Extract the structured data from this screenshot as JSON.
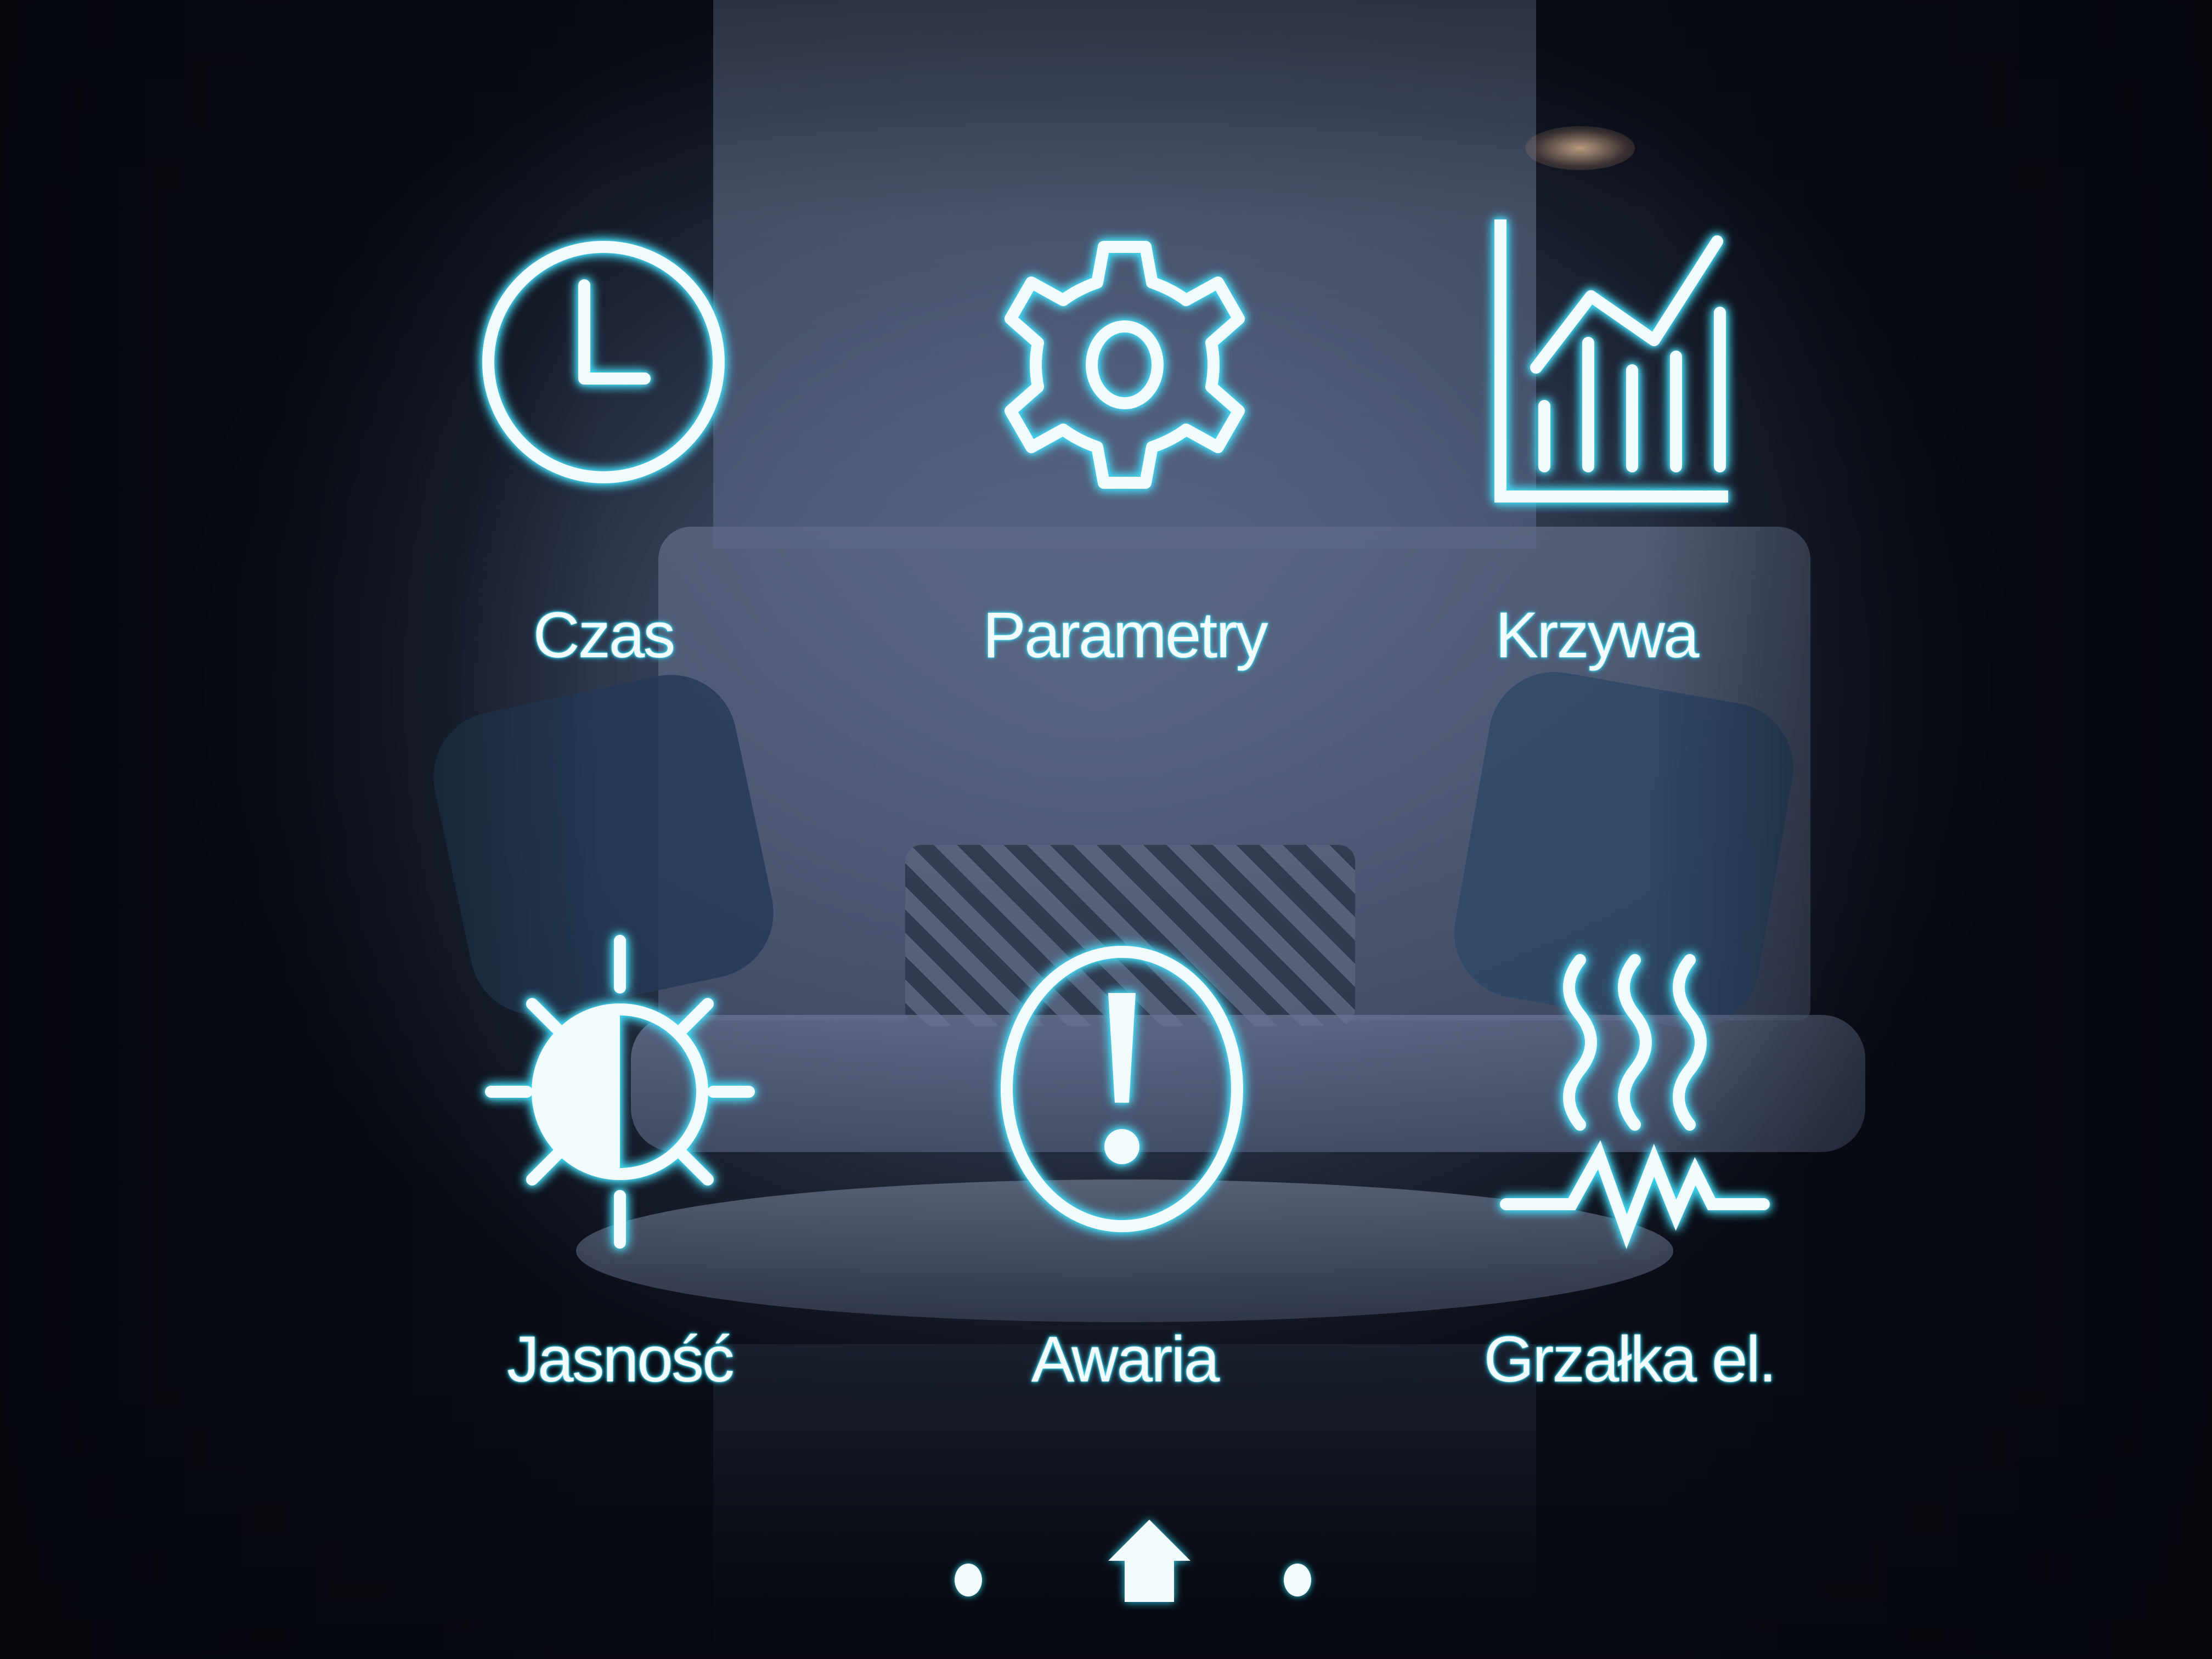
{
  "menu": {
    "items": [
      {
        "label": "Czas",
        "icon": "clock-icon"
      },
      {
        "label": "Parametry",
        "icon": "gear-icon"
      },
      {
        "label": "Krzywa",
        "icon": "chart-icon"
      },
      {
        "label": "Jasność",
        "icon": "brightness-icon"
      },
      {
        "label": "Awaria",
        "icon": "alert-icon"
      },
      {
        "label": "Grzałka el.",
        "icon": "heater-icon"
      }
    ]
  },
  "nav": {
    "icons": [
      "page-dot-icon",
      "home-icon",
      "page-dot-icon"
    ]
  },
  "theme": {
    "accent_glow": "#2fd4f0",
    "icon_color": "#f2fcff",
    "background": "#3f4c68"
  }
}
